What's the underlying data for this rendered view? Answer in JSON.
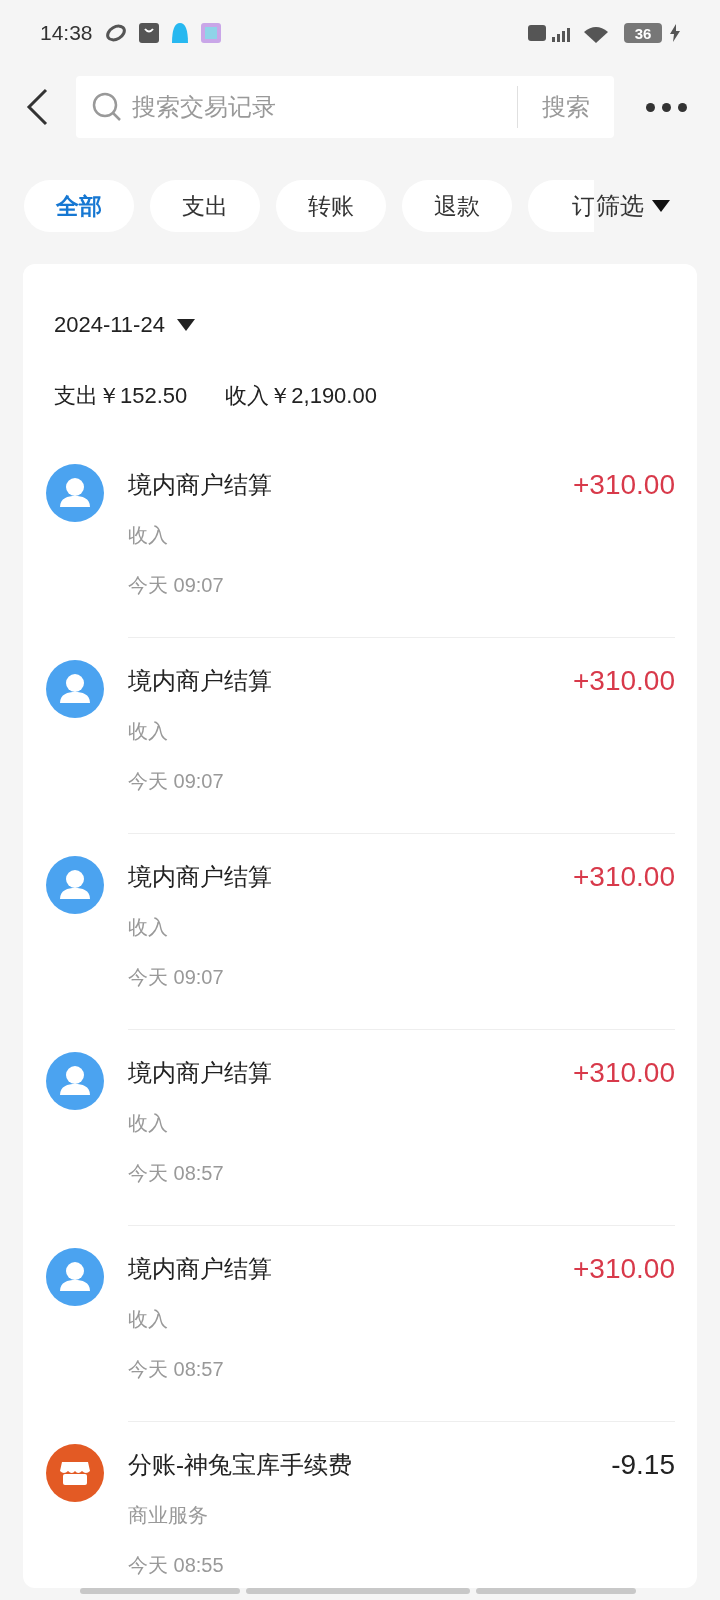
{
  "status_bar": {
    "time": "14:38",
    "battery": "36"
  },
  "search": {
    "placeholder": "搜索交易记录",
    "button": "搜索"
  },
  "tabs": [
    {
      "label": "全部",
      "selected": true
    },
    {
      "label": "支出",
      "selected": false
    },
    {
      "label": "转账",
      "selected": false
    },
    {
      "label": "退款",
      "selected": false
    },
    {
      "label": "订",
      "selected": false
    }
  ],
  "filter": {
    "label": "筛选"
  },
  "date": "2024-11-24",
  "summary": {
    "expense": "支出￥152.50",
    "income": "收入￥2,190.00"
  },
  "transactions": [
    {
      "kind": "income",
      "title": "境内商户结算",
      "category": "收入",
      "time": "今天 09:07",
      "amount": "+310.00"
    },
    {
      "kind": "income",
      "title": "境内商户结算",
      "category": "收入",
      "time": "今天 09:07",
      "amount": "+310.00"
    },
    {
      "kind": "income",
      "title": "境内商户结算",
      "category": "收入",
      "time": "今天 09:07",
      "amount": "+310.00"
    },
    {
      "kind": "income",
      "title": "境内商户结算",
      "category": "收入",
      "time": "今天 08:57",
      "amount": "+310.00"
    },
    {
      "kind": "income",
      "title": "境内商户结算",
      "category": "收入",
      "time": "今天 08:57",
      "amount": "+310.00"
    },
    {
      "kind": "expense",
      "title": "分账-神兔宝库手续费",
      "category": "商业服务",
      "time": "今天 08:55",
      "amount": "-9.15"
    }
  ]
}
